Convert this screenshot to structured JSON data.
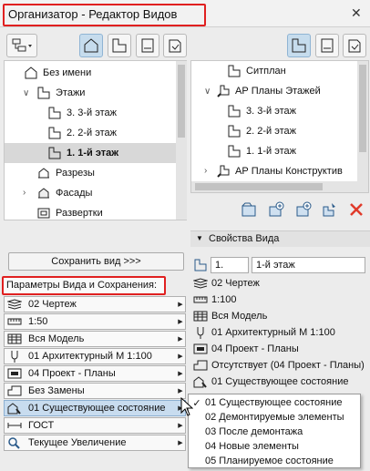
{
  "window": {
    "title": "Организатор - Редактор Видов",
    "close_glyph": "✕"
  },
  "left_tree": {
    "items": [
      {
        "label": "Без имени",
        "icon": "house-icon"
      },
      {
        "label": "Этажи",
        "icon": "floor-icon"
      },
      {
        "label": "3. 3-й этаж",
        "icon": "floor-icon"
      },
      {
        "label": "2. 2-й этаж",
        "icon": "floor-icon"
      },
      {
        "label": "1. 1-й этаж",
        "icon": "floor-icon",
        "selected": true
      },
      {
        "label": "Разрезы",
        "icon": "section-icon"
      },
      {
        "label": "Фасады",
        "icon": "elevation-icon"
      },
      {
        "label": "Развертки",
        "icon": "interior-elevation-icon"
      }
    ]
  },
  "right_tree": {
    "items": [
      {
        "label": "Ситплан",
        "icon": "floor-icon"
      },
      {
        "label": "АР Планы Этажей",
        "icon": "folder-icon"
      },
      {
        "label": "3. 3-й этаж",
        "icon": "floor-icon"
      },
      {
        "label": "2. 2-й этаж",
        "icon": "floor-icon"
      },
      {
        "label": "1. 1-й этаж",
        "icon": "floor-icon"
      },
      {
        "label": "АР Планы Конструктив",
        "icon": "folder-icon"
      }
    ]
  },
  "save_view_button": "Сохранить вид >>>",
  "params": {
    "title": "Параметры Вида и Сохранения:",
    "dropdowns": [
      {
        "value": "02 Чертеж",
        "icon": "layers-icon"
      },
      {
        "value": "1:50",
        "icon": "scale-icon"
      },
      {
        "value": "Вся Модель",
        "icon": "model-icon"
      },
      {
        "value": "01 Архитектурный М 1:100",
        "icon": "pen-icon"
      },
      {
        "value": "04 Проект - Планы",
        "icon": "mvo-icon"
      },
      {
        "value": "Без Замены",
        "icon": "override-icon"
      },
      {
        "value": "01 Существующее состояние",
        "icon": "renovation-icon",
        "highlighted": true
      },
      {
        "value": "ГОСТ",
        "icon": "dimension-icon"
      },
      {
        "value": "Текущее Увеличение",
        "icon": "zoom-icon"
      }
    ]
  },
  "view_props": {
    "title": "Свойства Вида",
    "id_value": "1.",
    "name_value": "1-й этаж",
    "rows": [
      {
        "value": "02 Чертеж",
        "icon": "layers-icon"
      },
      {
        "value": "1:100",
        "icon": "scale-icon"
      },
      {
        "value": "Вся Модель",
        "icon": "model-icon"
      },
      {
        "value": "01 Архитектурный М 1:100",
        "icon": "pen-icon"
      },
      {
        "value": "04 Проект - Планы",
        "icon": "mvo-icon"
      },
      {
        "value": "Отсутствует (04 Проект - Планы)",
        "icon": "override-icon"
      },
      {
        "value": "01 Существующее состояние",
        "icon": "renovation-icon"
      }
    ]
  },
  "renovation_menu": {
    "items": [
      {
        "label": "01 Существующее состояние",
        "checked": true
      },
      {
        "label": "02 Демонтируемые элементы",
        "checked": false
      },
      {
        "label": "03 После демонтажа",
        "checked": false
      },
      {
        "label": "04 Новые элементы",
        "checked": false
      },
      {
        "label": "05 Планируемое состояние",
        "checked": false
      }
    ]
  },
  "colors": {
    "accent_red": "#e02020",
    "highlight_blue": "#c8dcef",
    "delete_red": "#e03a2a"
  }
}
